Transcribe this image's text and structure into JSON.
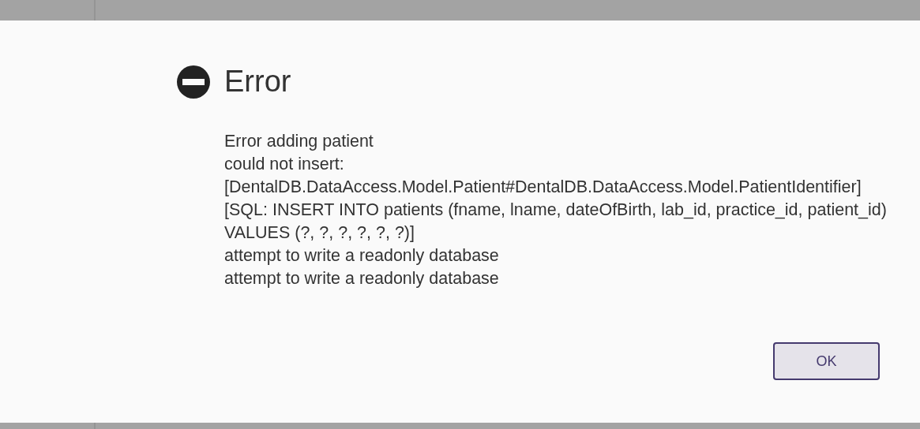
{
  "dialog": {
    "title": "Error",
    "message_lines": [
      "Error adding patient",
      "could not insert:",
      "[DentalDB.DataAccess.Model.Patient#DentalDB.DataAccess.Model.PatientIdentifier][SQL: INSERT INTO patients (fname, lname, dateOfBirth, lab_id, practice_id, patient_id) VALUES (?, ?, ?, ?, ?, ?)]",
      "attempt to write a readonly database",
      "attempt to write a readonly database"
    ],
    "buttons": [
      "OK"
    ]
  }
}
